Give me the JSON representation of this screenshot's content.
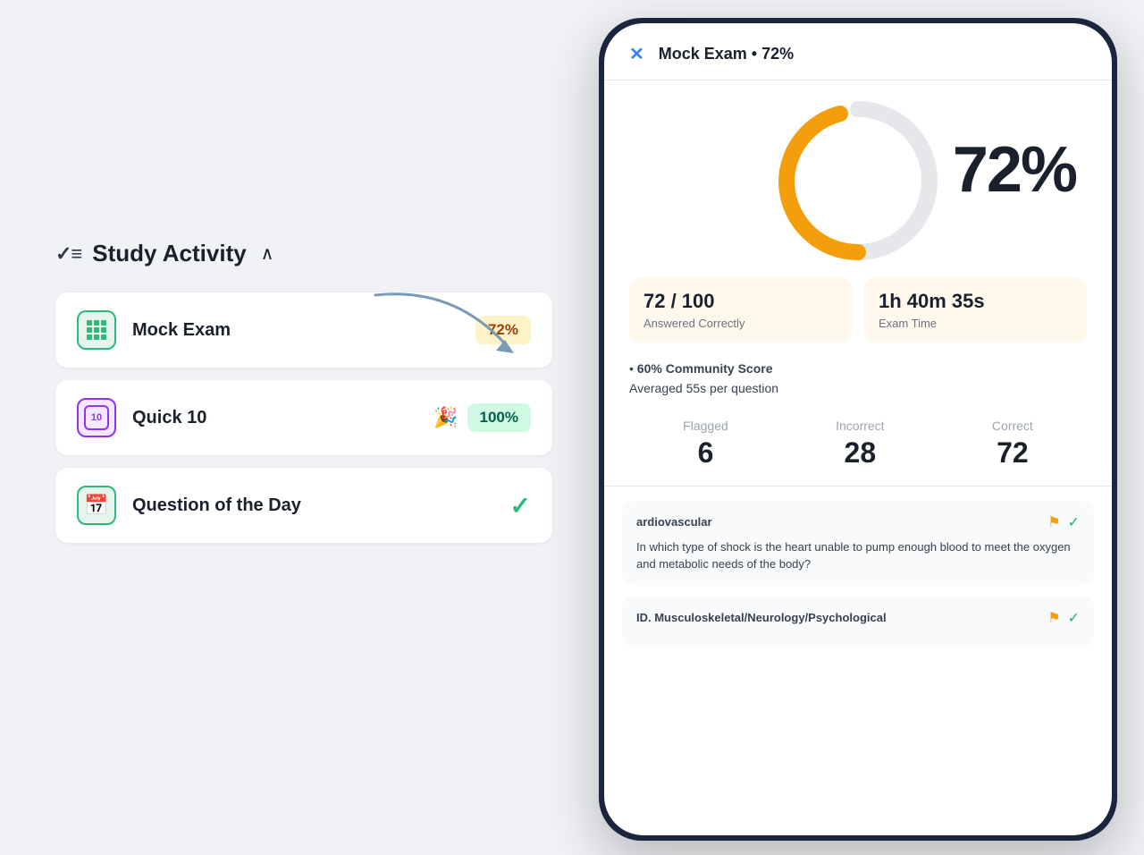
{
  "study": {
    "header_icon": "✓≡",
    "title": "Study Activity",
    "chevron": "^",
    "cards": [
      {
        "id": "mock-exam",
        "label": "Mock Exam",
        "badge": "72%",
        "badge_type": "yellow",
        "icon_type": "grid"
      },
      {
        "id": "quick-10",
        "label": "Quick 10",
        "badge": "100%",
        "badge_type": "green",
        "icon_type": "ten",
        "has_emoji": true,
        "emoji": "🎉"
      },
      {
        "id": "question-of-day",
        "label": "Question of the Day",
        "badge": "✓",
        "badge_type": "check",
        "icon_type": "calendar"
      }
    ]
  },
  "phone": {
    "close_label": "✕",
    "title": "Mock Exam • 72%",
    "score_percent": "72%",
    "stats": [
      {
        "main": "72 / 100",
        "sub": "Answered Correctly"
      },
      {
        "main": "1h 40m 35s",
        "sub": "Exam Time"
      }
    ],
    "community_score": "60% Community Score",
    "avg_time": "Averaged 55s per question",
    "fic": [
      {
        "label": "Flagged",
        "value": "6"
      },
      {
        "label": "Incorrect",
        "value": "28"
      },
      {
        "label": "Correct",
        "value": "72"
      }
    ],
    "questions": [
      {
        "category": "ardiovascular",
        "text": "In which type of shock is the heart unable to pump enough blood to meet the oxygen and metabolic needs of the body?",
        "flagged": true,
        "correct": true
      },
      {
        "category": "ID. Musculoskeletal/Neurology/Psychological",
        "text": "",
        "flagged": true,
        "correct": true
      }
    ]
  },
  "colors": {
    "accent_orange": "#f59e0b",
    "accent_green": "#2eb87a",
    "accent_purple": "#9333ea",
    "accent_blue": "#3b82f6",
    "dark": "#1a202c",
    "gray": "#6b7280"
  }
}
